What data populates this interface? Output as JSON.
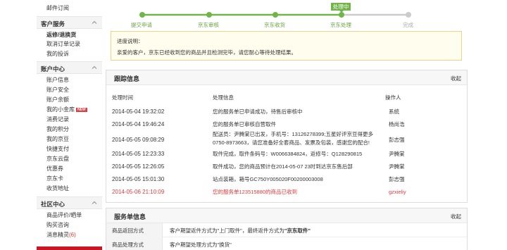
{
  "sidebar": {
    "top_link": "邮件订阅",
    "sections": [
      {
        "title": "客户服务",
        "items": [
          {
            "label": "返修/退换货",
            "bold": true
          },
          {
            "label": "取消订单记录"
          },
          {
            "label": "我的投诉"
          }
        ]
      },
      {
        "title": "账户中心",
        "items": [
          {
            "label": "账户信息"
          },
          {
            "label": "账户安全"
          },
          {
            "label": "账户余额"
          },
          {
            "label": "我的小金库",
            "badge": "NEW"
          },
          {
            "label": "消费记录"
          },
          {
            "label": "我的积分"
          },
          {
            "label": "我的京豆"
          },
          {
            "label": "快捷支付"
          },
          {
            "label": "京东云盘"
          },
          {
            "label": "优惠券"
          },
          {
            "label": "京东卡"
          },
          {
            "label": "收货地址"
          }
        ]
      },
      {
        "title": "社区中心",
        "items": [
          {
            "label": "商品评价/晒单"
          },
          {
            "label": "购买咨询"
          },
          {
            "label": "消息精灵",
            "count": "(6)"
          }
        ]
      }
    ]
  },
  "progress": {
    "current_tag": "处理中",
    "steps": [
      {
        "label": "提交申请",
        "done": true
      },
      {
        "label": "京东审核",
        "done": true
      },
      {
        "label": "京东收货",
        "done": true
      },
      {
        "label": "京东处理",
        "done": true
      },
      {
        "label": "完成",
        "done": false
      }
    ],
    "accent_color": "#70b548",
    "pending_color": "#cccccc"
  },
  "notice": {
    "title": "进度说明：",
    "text": "亲爱的客户，京东已经收到您的商品并且检测完毕，请您耐心等待处理结果。"
  },
  "tracking": {
    "title": "跟踪信息",
    "toggle": "收起",
    "columns": [
      "处理时间",
      "处理信息",
      "操作人"
    ],
    "rows": [
      {
        "time": "2014-05-04 19:32:02",
        "info": [
          "您的服务单已申请成功，待售后审核中"
        ],
        "operator": "系统"
      },
      {
        "time": "2014-05-04 19:46:24",
        "info": [
          "您的服务单已审核自营取件"
        ],
        "operator": "杨尚浩"
      },
      {
        "time": "2014-05-05 09:08:29",
        "info": [
          "配送员：尹腾棠已出发，手机号：13126278399;五星好评京豆得更多",
          "0750-8973663，请您准备好全套商品、发票及包装，感谢您的配合!"
        ],
        "operator": "彭志强"
      },
      {
        "time": "2014-05-05 12:23:33",
        "info": [
          "取件完成，取件条码号：W0066384824，返修号：Q128290815"
        ],
        "operator": "尹腾棠"
      },
      {
        "time": "2014-05-05 12:26:05",
        "info": [
          "取件成功，您的商品预计在2014-05-07 23时到达京东售后部"
        ],
        "operator": "尹腾棠"
      },
      {
        "time": "2014-05-05 15:01:30",
        "info": [
          "站点装箱，箱号GC750Y005020F00200003008"
        ],
        "operator": "彭志强"
      },
      {
        "time": "2014-05-06 21:10:09",
        "info": [
          "您的服务单123515880的商品已收到"
        ],
        "operator": "gzxieliy",
        "highlight": true
      }
    ]
  },
  "service": {
    "title": "服务单信息",
    "toggle": "收起",
    "rows": [
      {
        "label": "商品返回方式",
        "prefix": "客户期望返件方式为\"上门取件\"，最终返件方式为",
        "strong": "\"京东取件\""
      },
      {
        "label": "商品处理方式",
        "prefix": "客户期望处理方式为\"换货\"",
        "strong": ""
      }
    ]
  }
}
